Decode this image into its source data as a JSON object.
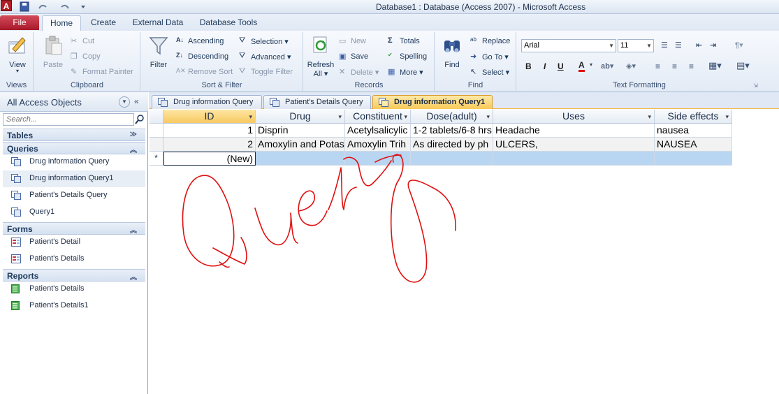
{
  "window": {
    "title": "Database1 : Database (Access 2007)  -  Microsoft Access"
  },
  "ribbon_tabs": [
    {
      "label": "File"
    },
    {
      "label": "Home"
    },
    {
      "label": "Create"
    },
    {
      "label": "External Data"
    },
    {
      "label": "Database Tools"
    }
  ],
  "ribbon": {
    "views": {
      "label": "Views",
      "view": "View"
    },
    "clipboard": {
      "label": "Clipboard",
      "paste": "Paste",
      "cut": "Cut",
      "copy": "Copy",
      "format_painter": "Format Painter"
    },
    "sort_filter": {
      "label": "Sort & Filter",
      "filter": "Filter",
      "ascending": "Ascending",
      "descending": "Descending",
      "remove_sort": "Remove Sort",
      "selection": "Selection ▾",
      "advanced": "Advanced ▾",
      "toggle_filter": "Toggle Filter"
    },
    "records": {
      "label": "Records",
      "refresh": "Refresh",
      "refresh_all": "All ▾",
      "new": "New",
      "save": "Save",
      "delete": "Delete ▾",
      "totals": "Totals",
      "spelling": "Spelling",
      "more": "More ▾"
    },
    "find": {
      "label": "Find",
      "find": "Find",
      "replace": "Replace",
      "goto": "Go To ▾",
      "select": "Select ▾"
    },
    "text_formatting": {
      "label": "Text Formatting",
      "font": "Arial",
      "size": "11",
      "bold": "B",
      "italic": "I",
      "underline": "U"
    }
  },
  "nav": {
    "title": "All Access Objects",
    "search_placeholder": "Search...",
    "sections": [
      {
        "label": "Tables",
        "items": []
      },
      {
        "label": "Queries",
        "items": [
          "Drug information Query",
          "Drug information Query1",
          "Patient's Details Query",
          "Query1"
        ]
      },
      {
        "label": "Forms",
        "items": [
          "Patient's Detail",
          "Patient's Details"
        ]
      },
      {
        "label": "Reports",
        "items": [
          "Patient's Details",
          "Patient's Details1"
        ]
      }
    ]
  },
  "doc_tabs": [
    "Drug information Query",
    "Patient's Details Query",
    "Drug information Query1"
  ],
  "grid": {
    "columns": [
      "ID",
      "Drug",
      "Constituent",
      "Dose(adult)",
      "Uses",
      "Side effects"
    ],
    "rows": [
      [
        "1",
        "Disprin",
        "Acetylsalicylic",
        "1-2 tablets/6-8 hrs",
        "Headache",
        "nausea"
      ],
      [
        "2",
        "Amoxylin and Potas",
        "Amoxylin Trih",
        "As directed by ph",
        "ULCERS,",
        "NAUSEA"
      ]
    ],
    "new_row_marker": "*",
    "new_row_label": "(New)"
  },
  "colors": {
    "accent": "#f7c961",
    "file_tab": "#b8172a",
    "scribble": "#e01010",
    "new_row": "#b8d6f2"
  }
}
